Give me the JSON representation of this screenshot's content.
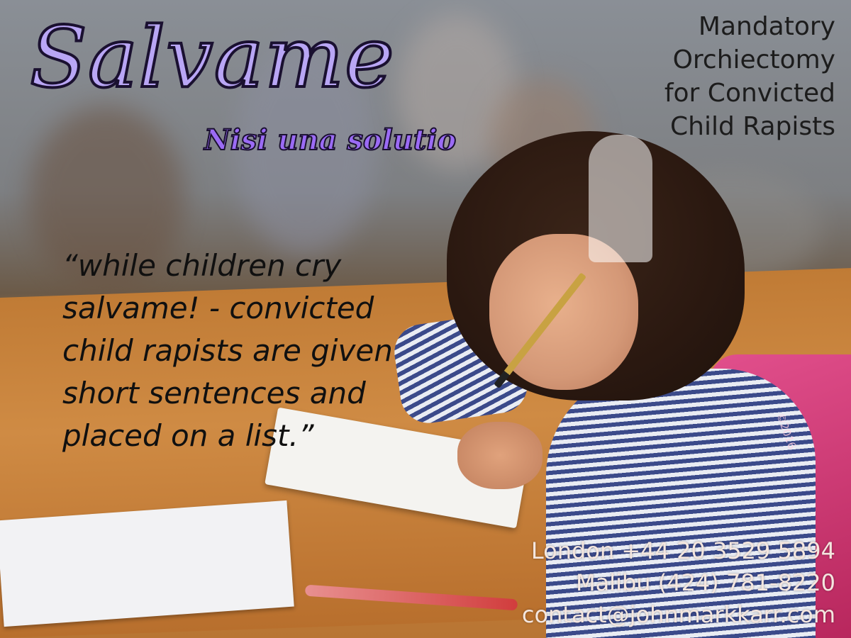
{
  "title": "Salvame",
  "subtitle": "Nisi una solutio",
  "headline": [
    "Mandatory",
    "Orchiectomy",
    "for Convicted",
    "Child Rapists"
  ],
  "quote": [
    "“while children cry",
    "salvame! - convicted",
    "child rapists are given",
    "short sentences and",
    "placed on a list.”"
  ],
  "contact": {
    "london": "London +44 20 3529 5894",
    "malibu": "Malibu (424) 781-8220",
    "email": "contact@johnmarkkarr.com"
  },
  "copyright": "©2016",
  "colors": {
    "title": "#b9a6f5",
    "subtitle": "#9b6bf5",
    "headline": "#1c1c1c",
    "contact": "#f4e6df"
  }
}
